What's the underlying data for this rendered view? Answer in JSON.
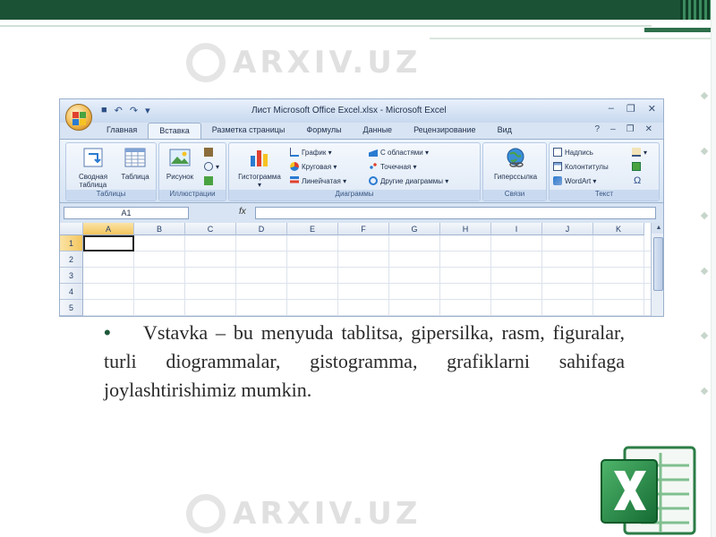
{
  "watermark": {
    "text": "ARXIV.UZ"
  },
  "excel": {
    "window_title": "Лист Microsoft Office Excel.xlsx - Microsoft Excel",
    "tabs": [
      "Главная",
      "Вставка",
      "Разметка страницы",
      "Формулы",
      "Данные",
      "Рецензирование",
      "Вид"
    ],
    "active_tab": "Вставка",
    "groups": {
      "tables": {
        "label": "Таблицы",
        "pivot": "Сводная таблица",
        "table": "Таблица"
      },
      "illustrations": {
        "label": "Иллюстрации",
        "picture": "Рисунок"
      },
      "charts": {
        "label": "Диаграммы",
        "histogram": "Гистограмма",
        "graph": "График",
        "pie": "Круговая",
        "line": "Линейчатая",
        "area": "С областями",
        "scatter": "Точечная",
        "other": "Другие диаграммы"
      },
      "links": {
        "label": "Связи",
        "hyperlink": "Гиперссылка"
      },
      "text": {
        "label": "Текст",
        "textbox": "Надпись",
        "header": "Колонтитулы",
        "wordart": "WordArt"
      }
    },
    "name_box": "A1",
    "fx": "fx",
    "columns": [
      "A",
      "B",
      "C",
      "D",
      "E",
      "F",
      "G",
      "H",
      "I",
      "J",
      "K"
    ],
    "rows": [
      "1",
      "2",
      "3",
      "4",
      "5"
    ]
  },
  "bullet": {
    "dot": "•",
    "text": "Vstavka – bu menyuda tablitsa, gipersilka, rasm, figuralar, turli diogrammalar, gistogramma, grafiklarni sahifaga joylashtirishimiz mumkin."
  },
  "colors": {
    "accent": "#1b5236",
    "excel_green": "#1e7a40"
  }
}
